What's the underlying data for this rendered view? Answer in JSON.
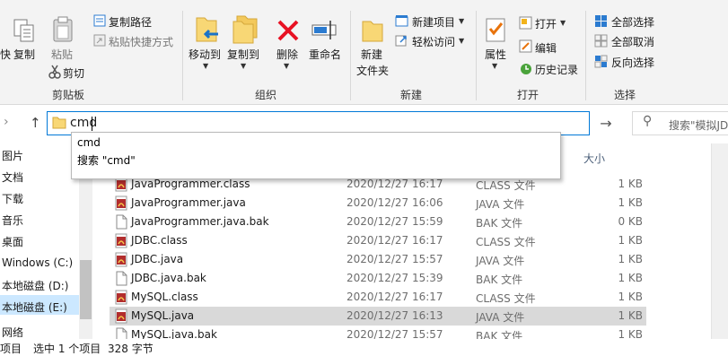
{
  "ribbon": {
    "clipboard": {
      "group_label": "剪贴板",
      "pin_partial": "快",
      "copy": "复制",
      "paste": "粘贴",
      "copy_path": "复制路径",
      "paste_shortcut": "粘贴快捷方式",
      "cut": "剪切"
    },
    "organize": {
      "group_label": "组织",
      "move_to": "移动到",
      "copy_to": "复制到",
      "delete": "删除",
      "rename": "重命名"
    },
    "new": {
      "group_label": "新建",
      "new_folder_line1": "新建",
      "new_folder_line2": "文件夹",
      "new_item": "新建项目",
      "easy_access": "轻松访问"
    },
    "open": {
      "group_label": "打开",
      "properties": "属性",
      "open": "打开",
      "edit": "编辑",
      "history": "历史记录"
    },
    "select": {
      "group_label": "选择",
      "select_all": "全部选择",
      "select_none": "全部取消",
      "invert": "反向选择"
    }
  },
  "address": {
    "value": "cmd",
    "search_placeholder": "搜索\"模拟JD"
  },
  "autocomplete": {
    "items": [
      "cmd",
      "搜索 \"cmd\""
    ]
  },
  "columns": {
    "size": "大小"
  },
  "nav": {
    "items": [
      "图片",
      "文档",
      "下载",
      "音乐",
      "桌面",
      "Windows (C:)",
      "本地磁盘 (D:)",
      "本地磁盘 (E:)",
      "网络"
    ]
  },
  "files": [
    {
      "name": "JavaProgrammer.class",
      "date": "2020/12/27 16:17",
      "type": "CLASS 文件",
      "size": "1 KB",
      "icon": "java-icon"
    },
    {
      "name": "JavaProgrammer.java",
      "date": "2020/12/27 16:06",
      "type": "JAVA 文件",
      "size": "1 KB",
      "icon": "java-icon"
    },
    {
      "name": "JavaProgrammer.java.bak",
      "date": "2020/12/27 15:59",
      "type": "BAK 文件",
      "size": "0 KB",
      "icon": "file-icon"
    },
    {
      "name": "JDBC.class",
      "date": "2020/12/27 16:17",
      "type": "CLASS 文件",
      "size": "1 KB",
      "icon": "java-icon"
    },
    {
      "name": "JDBC.java",
      "date": "2020/12/27 15:57",
      "type": "JAVA 文件",
      "size": "1 KB",
      "icon": "java-icon"
    },
    {
      "name": "JDBC.java.bak",
      "date": "2020/12/27 15:39",
      "type": "BAK 文件",
      "size": "1 KB",
      "icon": "file-icon"
    },
    {
      "name": "MySQL.class",
      "date": "2020/12/27 16:17",
      "type": "CLASS 文件",
      "size": "1 KB",
      "icon": "java-icon"
    },
    {
      "name": "MySQL.java",
      "date": "2020/12/27 16:13",
      "type": "JAVA 文件",
      "size": "1 KB",
      "icon": "java-icon",
      "selected": true
    },
    {
      "name": "MySQL.java.bak",
      "date": "2020/12/27 15:57",
      "type": "BAK 文件",
      "size": "1 KB",
      "icon": "file-icon"
    }
  ],
  "status": {
    "count_partial": "项目",
    "selected": "选中 1 个项目",
    "bytes": "328 字节"
  },
  "colors": {
    "accent": "#0078d7",
    "selected_row": "#d9d9d9",
    "delete_red": "#e81123",
    "folder_yellow": "#f8d775"
  }
}
